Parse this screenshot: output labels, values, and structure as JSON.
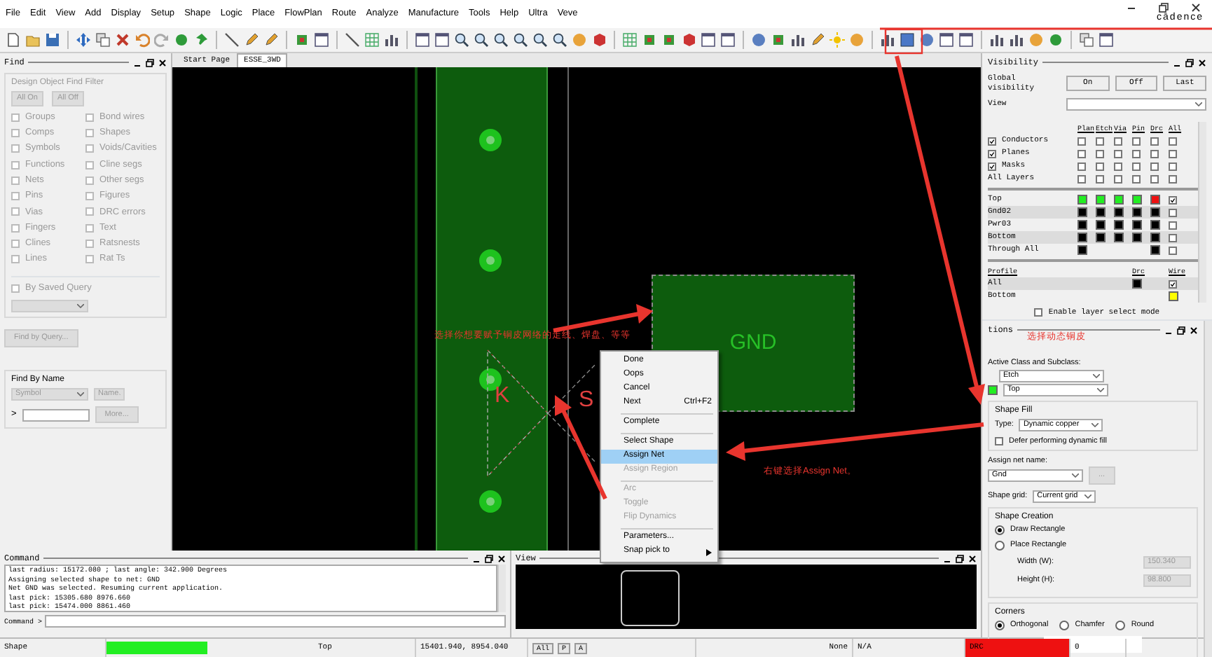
{
  "menu_bar": {
    "items": [
      "File",
      "Edit",
      "View",
      "Add",
      "Display",
      "Setup",
      "Shape",
      "Logic",
      "Place",
      "FlowPlan",
      "Route",
      "Analyze",
      "Manufacture",
      "Tools",
      "Help",
      "Ultra",
      "Veve"
    ],
    "logo": "cādence"
  },
  "find_panel": {
    "title": "Find",
    "filter": {
      "title": "Design Object Find Filter",
      "disabled": true,
      "buttons": [
        "All On",
        "All Off"
      ],
      "options": [
        {
          "label": "Groups",
          "checked": false
        },
        {
          "label": "Bond wires",
          "checked": false
        },
        {
          "label": "Comps",
          "checked": false
        },
        {
          "label": "Shapes",
          "checked": false
        },
        {
          "label": "Symbols",
          "checked": false
        },
        {
          "label": "Voids/Cavities",
          "checked": false
        },
        {
          "label": "Functions",
          "checked": false
        },
        {
          "label": "Cline segs",
          "checked": false
        },
        {
          "label": "Nets",
          "checked": false
        },
        {
          "label": "Other segs",
          "checked": false
        },
        {
          "label": "Pins",
          "checked": false
        },
        {
          "label": "Figures",
          "checked": false
        },
        {
          "label": "Vias",
          "checked": false
        },
        {
          "label": "DRC errors",
          "checked": false
        },
        {
          "label": "Fingers",
          "checked": false
        },
        {
          "label": "Text",
          "checked": false
        },
        {
          "label": "Clines",
          "checked": false
        },
        {
          "label": "Ratsnests",
          "checked": false
        },
        {
          "label": "Lines",
          "checked": false
        },
        {
          "label": "Rat Ts",
          "checked": false
        }
      ],
      "saved_query": {
        "label": "By Saved Query",
        "checked": false
      }
    },
    "query_button": "Find by Query...",
    "find_by_name": {
      "title": "Find By Name",
      "type": "Symbol",
      "mode": "Name",
      "prompt": ">",
      "more": "More..."
    }
  },
  "canvas": {
    "tabs": [
      {
        "label": "Start Page",
        "selected": false
      },
      {
        "label": "ESSE_3WD",
        "selected": true
      }
    ],
    "shape_label": "GND",
    "silkscreen": [
      "K",
      "S"
    ]
  },
  "annotations": [
    "选择你想要赋予铜皮网络的走线、焊盘、等等",
    "右键选择Assign Net。",
    "选择动态铜皮"
  ],
  "context_menu": {
    "items": [
      {
        "kind": "item",
        "label": "Done",
        "selected": false,
        "disabled": false
      },
      {
        "kind": "item",
        "label": "Oops",
        "selected": false,
        "disabled": false
      },
      {
        "kind": "item",
        "label": "Cancel",
        "selected": false,
        "disabled": false
      },
      {
        "kind": "item",
        "label": "Next",
        "shortcut": "Ctrl+F2",
        "selected": false,
        "disabled": false
      },
      {
        "kind": "separator"
      },
      {
        "kind": "item",
        "label": "Complete",
        "selected": false,
        "disabled": false
      },
      {
        "kind": "separator"
      },
      {
        "kind": "item",
        "label": "Select Shape",
        "selected": false,
        "disabled": false
      },
      {
        "kind": "item",
        "label": "Assign Net",
        "selected": true,
        "disabled": false
      },
      {
        "kind": "item",
        "label": "Assign Region",
        "selected": false,
        "disabled": true
      },
      {
        "kind": "separator"
      },
      {
        "kind": "item",
        "label": "Arc",
        "selected": false,
        "disabled": true
      },
      {
        "kind": "item",
        "label": "Toggle",
        "selected": false,
        "disabled": true
      },
      {
        "kind": "item",
        "label": "Flip Dynamics",
        "selected": false,
        "disabled": true
      },
      {
        "kind": "separator"
      },
      {
        "kind": "item",
        "label": "Parameters...",
        "selected": false,
        "disabled": false
      },
      {
        "kind": "submenu",
        "label": "Snap pick to",
        "selected": false,
        "disabled": false
      }
    ]
  },
  "visibility_panel": {
    "title": "Visibility",
    "global_label": "Global visibility",
    "buttons": [
      "On",
      "Off",
      "Last"
    ],
    "view_label": "View",
    "columns": [
      "Plan",
      "Etch",
      "Via",
      "Pin",
      "Drc",
      "All"
    ],
    "groups": [
      {
        "label": "Conductors",
        "checked": true,
        "cells": [
          false,
          false,
          false,
          false,
          false,
          false
        ]
      },
      {
        "label": "Planes",
        "checked": true,
        "cells": [
          false,
          false,
          false,
          false,
          false,
          false
        ]
      },
      {
        "label": "Masks",
        "checked": true,
        "cells": [
          false,
          false,
          false,
          false,
          false,
          false
        ]
      }
    ],
    "all_layers": {
      "label": "All Layers",
      "cells": [
        false,
        false,
        false,
        false,
        false,
        false
      ]
    },
    "layers": [
      {
        "name": "Top",
        "cells": [
          {
            "color": "#22ee22"
          },
          {
            "color": "#22ee22"
          },
          {
            "color": "#22ee22"
          },
          {
            "color": "#22ee22"
          },
          {
            "color": "#ee1111"
          }
        ],
        "all": true
      },
      {
        "name": "Gnd02",
        "cells": [
          {
            "color": "#000000"
          },
          {
            "color": "#000000"
          },
          {
            "color": "#000000"
          },
          {
            "color": "#000000"
          },
          {
            "color": "#000000"
          }
        ],
        "all": false
      },
      {
        "name": "Pwr03",
        "cells": [
          {
            "color": "#000000"
          },
          {
            "color": "#000000"
          },
          {
            "color": "#000000"
          },
          {
            "color": "#000000"
          },
          {
            "color": "#000000"
          }
        ],
        "all": false
      },
      {
        "name": "Bottom",
        "cells": [
          {
            "color": "#000000"
          },
          {
            "color": "#000000"
          },
          {
            "color": "#000000"
          },
          {
            "color": "#000000"
          },
          {
            "color": "#000000"
          }
        ],
        "all": false
      },
      {
        "name": "Through All",
        "cells": [
          {
            "color": "#000000"
          },
          null,
          null,
          null,
          {
            "color": "#000000"
          }
        ],
        "all": false
      }
    ],
    "profile": {
      "title": "Profile",
      "columns": [
        "Drc",
        "Wire"
      ],
      "rows": [
        {
          "name": "All",
          "drc": {
            "color": "#000000"
          },
          "wire_checked": true
        },
        {
          "name": "Bottom",
          "wire": {
            "color": "#ffff00"
          }
        }
      ]
    },
    "layer_select": {
      "label": "Enable layer select mode",
      "checked": false
    }
  },
  "options_panel": {
    "title": "tions",
    "active_class": {
      "label": "Active Class and Subclass:",
      "class": "Etch",
      "subclass": "Top"
    },
    "shape_fill": {
      "title": "Shape Fill",
      "type_label": "Type:",
      "type": "Dynamic copper",
      "defer": {
        "label": "Defer performing dynamic fill",
        "checked": false
      }
    },
    "net": {
      "label": "Assign net name:",
      "value": "Gnd",
      "browse": "..."
    },
    "grid": {
      "label": "Shape grid:",
      "value": "Current grid"
    },
    "creation": {
      "title": "Shape Creation",
      "modes": [
        {
          "label": "Draw Rectangle",
          "selected": true
        },
        {
          "label": "Place Rectangle",
          "selected": false
        }
      ],
      "width": {
        "label": "Width (W):",
        "value": "150.340",
        "disabled": true
      },
      "height": {
        "label": "Height (H):",
        "value": "98.800",
        "disabled": true
      }
    },
    "corners": {
      "title": "Corners",
      "options": [
        {
          "label": "Orthogonal",
          "selected": true
        },
        {
          "label": "Chamfer",
          "selected": false
        },
        {
          "label": "Round",
          "selected": false
        }
      ]
    }
  },
  "command_panel": {
    "title": "Command",
    "log": [
      "last radius: 15172.080 ; last angle: 342.900 Degrees",
      "Assigning selected shape to net: GND",
      "Net GND was selected. Resuming current application.",
      "last pick:  15305.680 8976.660",
      "last pick:  15474.000 8861.460"
    ],
    "prompt": "Command >"
  },
  "view_panel": {
    "title": "View"
  },
  "status_bar": {
    "mode": "Shape",
    "layer": "Top",
    "coordinates": "15401.940, 8954.040",
    "buttons": [
      "All",
      "P",
      "A"
    ],
    "selection": "None",
    "field_2": "N/A",
    "drc_label": "DRC",
    "drc_count": "0"
  }
}
